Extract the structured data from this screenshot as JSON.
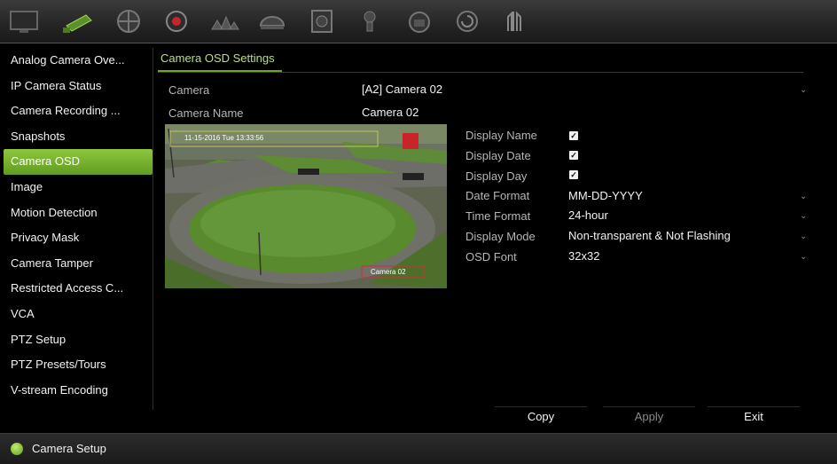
{
  "toolbar": {
    "icons": [
      "monitor-icon",
      "camera-icon",
      "network-icon",
      "record-icon",
      "alarm-icon",
      "hdd-icon",
      "storage-icon",
      "user-icon",
      "system-icon",
      "backup-icon",
      "shutdown-icon"
    ],
    "active": "camera-icon"
  },
  "sidebar": {
    "items": [
      {
        "label": "Analog Camera Ove..."
      },
      {
        "label": "IP Camera Status"
      },
      {
        "label": "Camera Recording ..."
      },
      {
        "label": "Snapshots"
      },
      {
        "label": "Camera OSD",
        "active": true
      },
      {
        "label": "Image"
      },
      {
        "label": "Motion Detection"
      },
      {
        "label": "Privacy Mask"
      },
      {
        "label": "Camera Tamper"
      },
      {
        "label": "Restricted Access C..."
      },
      {
        "label": "VCA"
      },
      {
        "label": "PTZ Setup"
      },
      {
        "label": "PTZ Presets/Tours"
      },
      {
        "label": "V-stream Encoding"
      }
    ]
  },
  "tab": {
    "label": "Camera OSD Settings"
  },
  "form": {
    "camera_label": "Camera",
    "camera_value": "[A2] Camera 02",
    "camera_name_label": "Camera Name",
    "camera_name_value": "Camera 02",
    "display_name_label": "Display Name",
    "display_name_checked": true,
    "display_date_label": "Display Date",
    "display_date_checked": true,
    "display_day_label": "Display Day",
    "display_day_checked": true,
    "date_format_label": "Date Format",
    "date_format_value": "MM-DD-YYYY",
    "time_format_label": "Time Format",
    "time_format_value": "24-hour",
    "display_mode_label": "Display Mode",
    "display_mode_value": "Non-transparent & Not Flashing",
    "osd_font_label": "OSD Font",
    "osd_font_value": "32x32"
  },
  "preview": {
    "timestamp": "11-15-2016 Tue 13:33:56",
    "name_overlay": "Camera 02"
  },
  "buttons": {
    "copy": "Copy",
    "apply": "Apply",
    "exit": "Exit"
  },
  "status": {
    "text": "Camera Setup"
  },
  "colors": {
    "accent": "#7bb534",
    "background": "#000000",
    "text": "#e8e8e8"
  }
}
